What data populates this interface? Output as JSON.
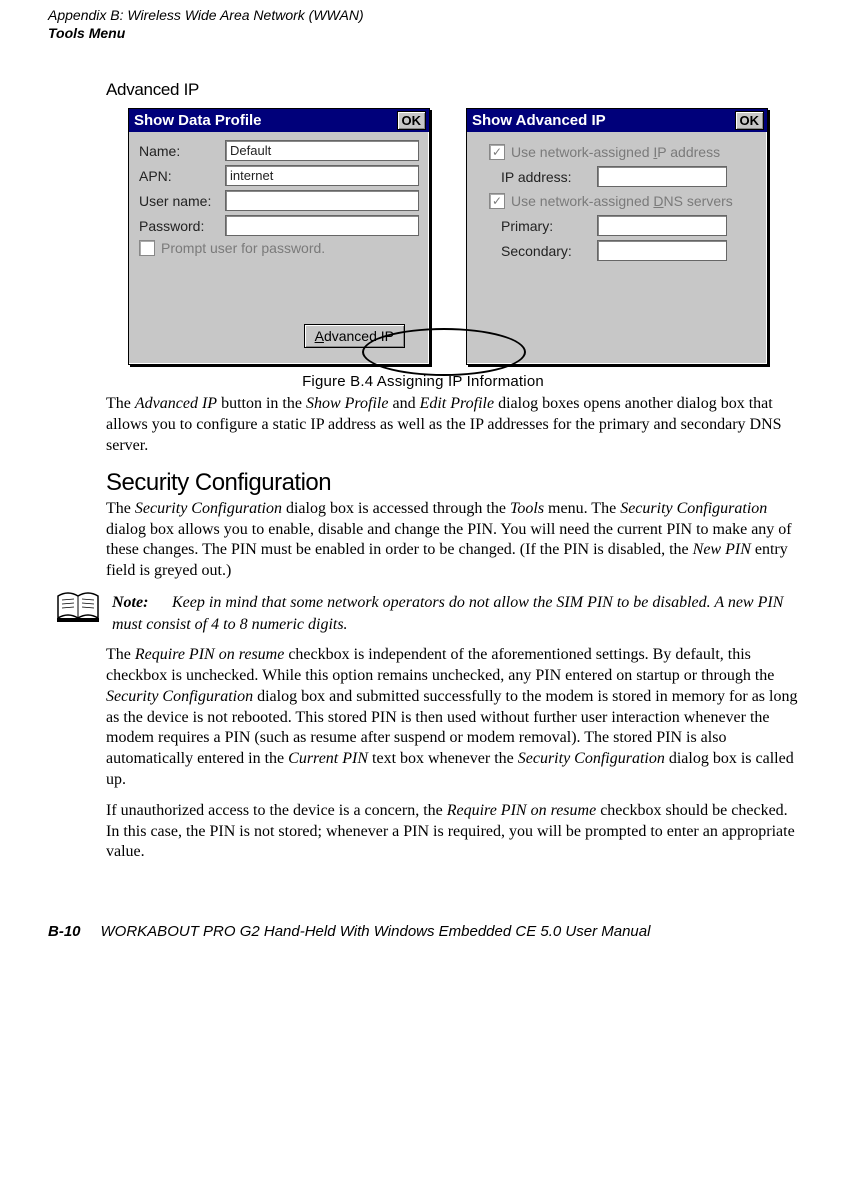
{
  "header": {
    "line1": "Appendix B: Wireless Wide Area Network (WWAN)",
    "line2": "Tools Menu"
  },
  "advanced_ip": {
    "heading": "Advanced IP"
  },
  "win1": {
    "title": "Show Data Profile",
    "ok": "OK",
    "labels": {
      "name": "Name:",
      "apn": "APN:",
      "user": "User name:",
      "password": "Password:"
    },
    "values": {
      "name": "Default",
      "apn": "internet",
      "user": "",
      "password": ""
    },
    "prompt_checkbox": "Prompt user for password.",
    "adv_btn_pre": "A",
    "adv_btn_rest": "dvanced IP"
  },
  "win2": {
    "title": "Show Advanced IP",
    "ok": "OK",
    "use_ip_pre": "Use network-assigned ",
    "use_ip_letter": "I",
    "use_ip_post": "P address",
    "ip_label": "IP address:",
    "use_dns_pre": "Use network-assigned ",
    "use_dns_letter": "D",
    "use_dns_post": "NS servers",
    "primary_label": "Primary:",
    "secondary_label": "Secondary:"
  },
  "figure_caption": "Figure B.4   Assigning IP Information",
  "para1_a": "The ",
  "para1_b": "Advanced IP",
  "para1_c": " button in the ",
  "para1_d": "Show Profile",
  "para1_e": " and ",
  "para1_f": "Edit Profile",
  "para1_g": " dialog boxes opens another dialog box that allows you to configure a static IP address as well as the IP addresses for the primary and secondary DNS server.",
  "security_heading": "Security Configuration",
  "para2_a": "The ",
  "para2_b": "Security Configuration",
  "para2_c": " dialog box is accessed through the ",
  "para2_d": "Tools",
  "para2_e": " menu. The ",
  "para2_f": "Security Configuration",
  "para2_g": " dialog box allows you to enable, disable and change the PIN. You will need the current PIN to make any of these changes. The PIN must be enabled in order to be changed. (If the PIN is disabled, the ",
  "para2_h": "New PIN",
  "para2_i": " entry field is greyed out.)",
  "note_label": "Note:",
  "note_text": "Keep in mind that some network operators do not allow the SIM PIN to be disabled. A new PIN must consist of 4 to 8 numeric digits.",
  "para3_a": "The ",
  "para3_b": "Require PIN on resume",
  "para3_c": " checkbox is independent of the aforementioned settings. By default, this checkbox is unchecked. While this option remains unchecked, any PIN entered on startup or through the ",
  "para3_d": "Security Configuration",
  "para3_e": " dialog box and submitted successfully to the modem is stored in memory for as long as the device is not rebooted. This stored PIN is then used without further user interaction whenever the modem requires a PIN (such as resume after suspend or modem removal). The stored PIN is also automatically entered in the ",
  "para3_f": "Current PIN",
  "para3_g": " text box whenever the ",
  "para3_h": "Security Configuration",
  "para3_i": " dialog box is called up.",
  "para4_a": "If unauthorized access to the device is a concern, the ",
  "para4_b": "Require PIN on resume",
  "para4_c": " checkbox should be checked. In this case, the PIN is not stored; whenever a PIN is required, you will be prompted to enter an appropriate value.",
  "footer": {
    "page": "B-10",
    "doc": "WORKABOUT PRO G2 Hand-Held With Windows Embedded CE 5.0 User Manual"
  }
}
